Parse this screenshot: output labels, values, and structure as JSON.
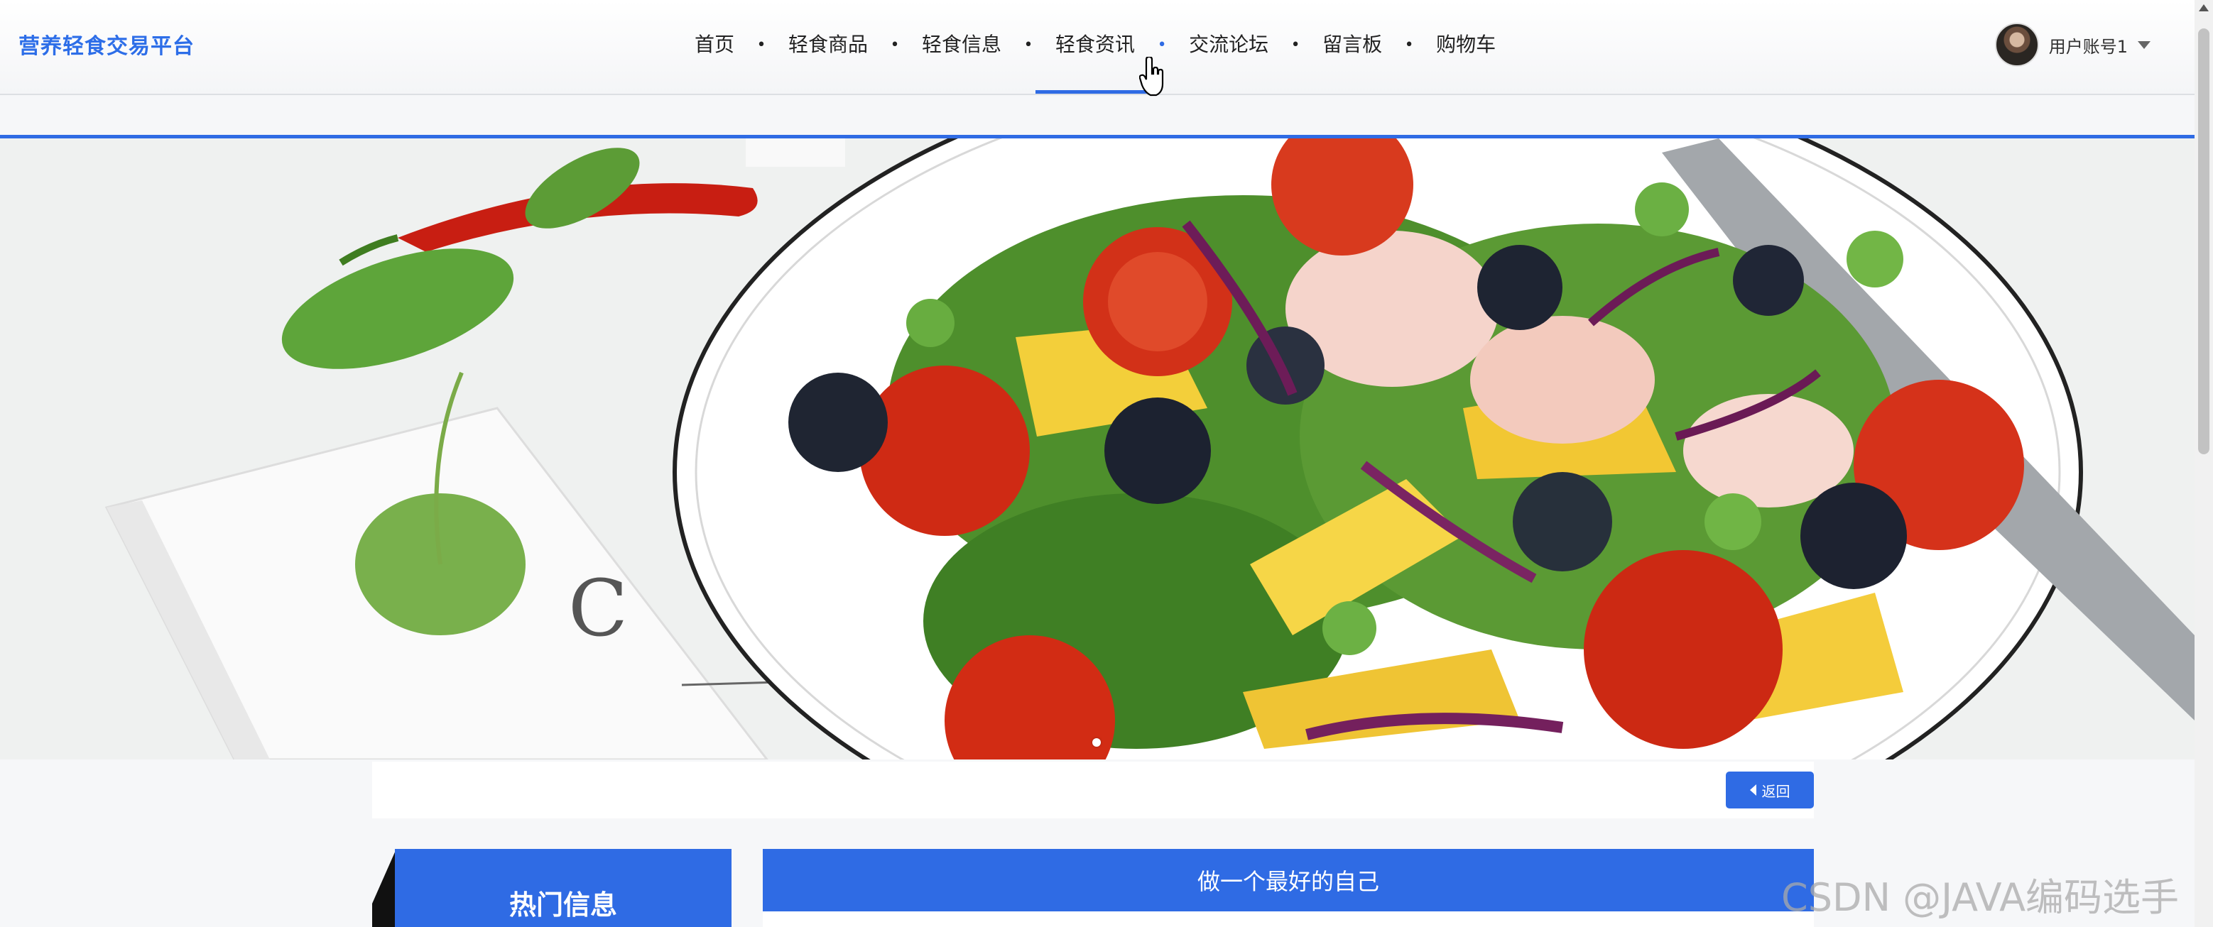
{
  "header": {
    "brand": "营养轻食交易平台",
    "nav": [
      "首页",
      "轻食商品",
      "轻食信息",
      "轻食资讯",
      "交流论坛",
      "留言板",
      "购物车"
    ],
    "active_nav": "轻食资讯",
    "user_name": "用户账号1"
  },
  "banner": {
    "slide_count": 1,
    "active_slide": 1
  },
  "back_button": {
    "label": "返回"
  },
  "sidebar": {
    "title": "热门信息"
  },
  "article": {
    "title": "做一个最好的自己"
  },
  "watermark": "CSDN @JAVA编码选手",
  "colors": {
    "accent": "#2f6be4",
    "brand": "#2d6ee8"
  },
  "icons": [
    "user-avatar-icon",
    "chevron-down-icon",
    "caret-left-icon",
    "hand-cursor-icon"
  ]
}
